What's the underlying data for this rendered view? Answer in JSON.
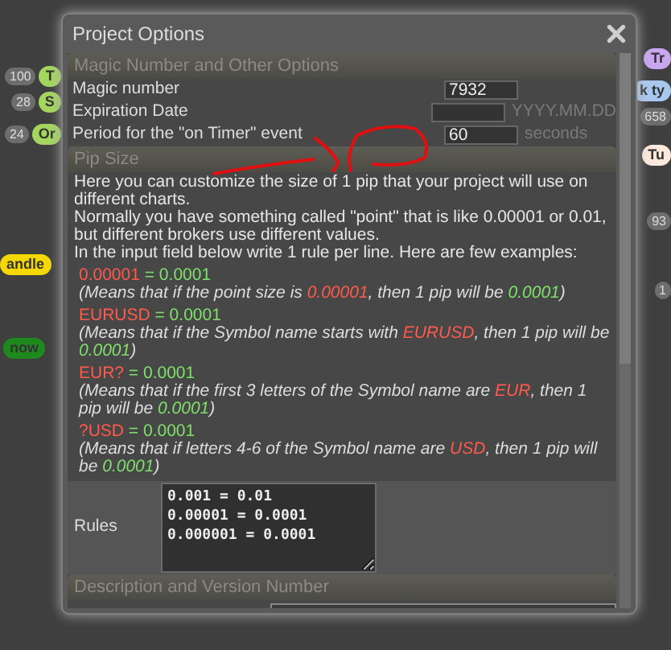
{
  "background_nodes": [
    {
      "badge": "100",
      "label": "T",
      "color": "#a4d65e"
    },
    {
      "badge": "28",
      "label": "S",
      "color": "#a4d65e"
    },
    {
      "badge": "24",
      "label": "Or",
      "color": "#a4d65e"
    },
    {
      "label": "andle",
      "color": "#f5d800"
    },
    {
      "label": "now",
      "color": "#1e8a1e"
    },
    {
      "label": "Tr",
      "color": "#c9a7f0"
    },
    {
      "label": "k ty",
      "color": "#a9c8f0"
    },
    {
      "badge": "658"
    },
    {
      "label": "Tu",
      "color": "#fde9dc"
    },
    {
      "badge": "93"
    },
    {
      "badge": "1"
    }
  ],
  "dialog": {
    "title": "Project Options",
    "sections": [
      {
        "kind": "fields",
        "title": "Magic Number and Other Options",
        "fields": [
          {
            "label": "Magic number",
            "value": "7932"
          },
          {
            "label": "Expiration Date",
            "hint": "YYYY.MM.DD"
          },
          {
            "label": "Period for the \"on Timer\" event",
            "value": "60",
            "hint": "seconds"
          }
        ]
      },
      {
        "kind": "pip",
        "title": "Pip Size",
        "intro": [
          "Here you can customize the size of 1 pip that your project will use on different charts.",
          "Normally you have something called \"point\" that is like 0.00001 or 0.01, but different brokers use different values.",
          "In the input field below write 1 rule per line. Here are few examples:"
        ],
        "examples": [
          {
            "pattern": "0.00001",
            "value": " = 0.0001",
            "explanation": [
              {
                "text": "(Means that if the point size is "
              },
              {
                "text": "0.00001",
                "color": "#ff5a4a"
              },
              {
                "text": ", then 1 pip will be "
              },
              {
                "text": "0.0001",
                "color": "#7ee06a"
              },
              {
                "text": ")"
              }
            ]
          },
          {
            "pattern": "EURUSD",
            "value": " = 0.0001",
            "explanation": [
              {
                "text": "(Means that if the Symbol name starts with "
              },
              {
                "text": "EURUSD",
                "color": "#ff5a4a"
              },
              {
                "text": ", then 1 pip will be "
              },
              {
                "text": "0.0001",
                "color": "#7ee06a"
              },
              {
                "text": ")"
              }
            ]
          },
          {
            "pattern": "EUR?",
            "value": " = 0.0001",
            "explanation": [
              {
                "text": "(Means that if the first 3 letters of the Symbol name are "
              },
              {
                "text": "EUR",
                "color": "#ff5a4a"
              },
              {
                "text": ", then 1 pip will be "
              },
              {
                "text": "0.0001",
                "color": "#7ee06a"
              },
              {
                "text": ")"
              }
            ]
          },
          {
            "pattern": "?USD",
            "value": " = 0.0001",
            "explanation": [
              {
                "text": "(Means that if letters 4-6 of the Symbol name are "
              },
              {
                "text": "USD",
                "color": "#ff5a4a"
              },
              {
                "text": ", then 1 pip will be "
              },
              {
                "text": "0.0001",
                "color": "#7ee06a"
              },
              {
                "text": ")"
              }
            ]
          }
        ],
        "rules_label": "Rules",
        "rules": "0.001 = 0.01\n0.00001 = 0.0001\n0.000001 = 0.0001"
      },
      {
        "kind": "fields",
        "title": "Description and Version Number"
      }
    ]
  }
}
